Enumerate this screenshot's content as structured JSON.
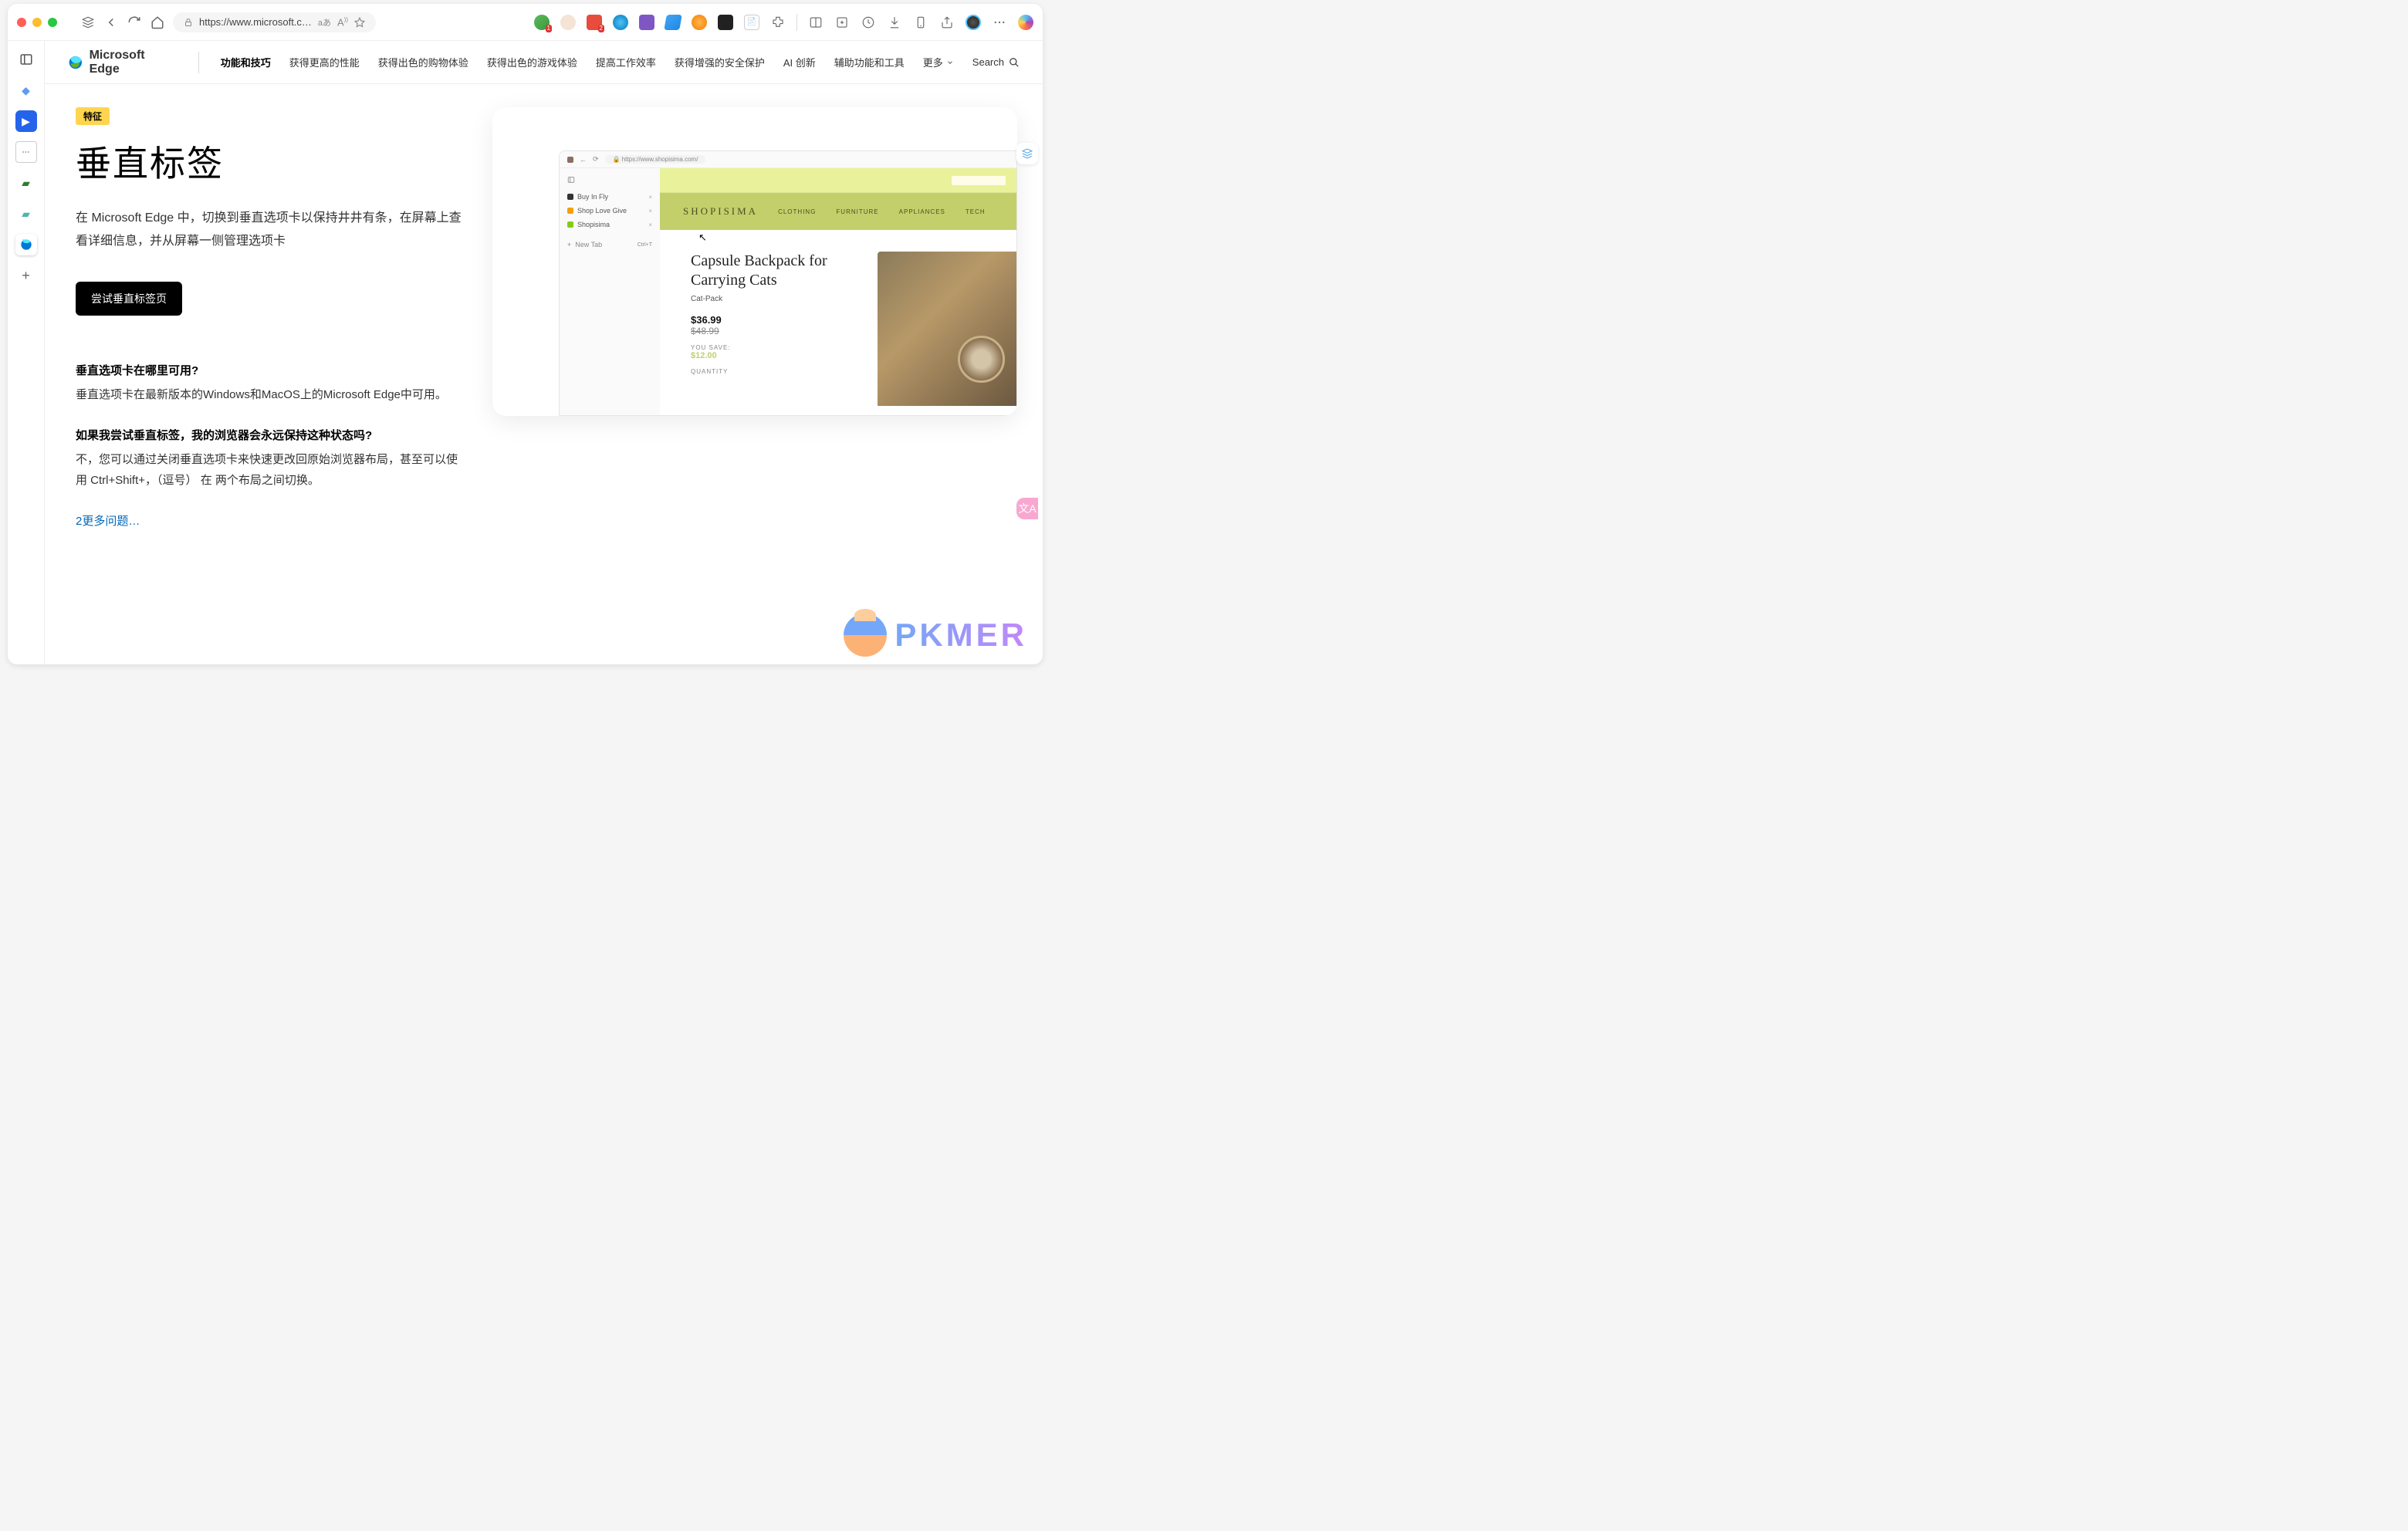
{
  "chrome": {
    "url": "https://www.microsoft.c…",
    "lang_indicator": "aあ",
    "ext_badges": {
      "green": "1",
      "red": "2"
    }
  },
  "left_rail": {
    "items": [
      "panel",
      "diamond",
      "play",
      "subtitle",
      "flag-green",
      "flag-teal",
      "edge"
    ],
    "plus": "+"
  },
  "site_nav": {
    "brand": "Microsoft Edge",
    "links": [
      "功能和技巧",
      "获得更高的性能",
      "获得出色的购物体验",
      "获得出色的游戏体验",
      "提高工作效率",
      "获得增强的安全保护",
      "AI 创新",
      "辅助功能和工具"
    ],
    "more": "更多",
    "search": "Search"
  },
  "page": {
    "badge": "特征",
    "title": "垂直标签",
    "desc": "在 Microsoft Edge 中，切换到垂直选项卡以保持井井有条，在屏幕上查看详细信息，并从屏幕一侧管理选项卡",
    "cta": "尝试垂直标签页",
    "faq": [
      {
        "q": "垂直选项卡在哪里可用?",
        "a": "垂直选项卡在最新版本的Windows和MacOS上的Microsoft Edge中可用。"
      },
      {
        "q": "如果我尝试垂直标签，我的浏览器会永远保持这种状态吗?",
        "a": "不，您可以通过关闭垂直选项卡来快速更改回原始浏览器布局，甚至可以使用 Ctrl+Shift+，（逗号） 在 两个布局之间切换。"
      }
    ],
    "more_link": "2更多问题…"
  },
  "demo": {
    "url": "https://www.shopisima.com/",
    "tabs": [
      {
        "name": "Buy In Fly",
        "color": "#333"
      },
      {
        "name": "Shop Love Give",
        "color": "#f59e0b"
      },
      {
        "name": "Shopisima",
        "color": "#84cc16"
      }
    ],
    "new_tab": "New Tab",
    "new_tab_kbd": "Ctrl+T",
    "logo": "SHOPISIMA",
    "nav": [
      "CLOTHING",
      "FURNITURE",
      "APPLIANCES",
      "TECH"
    ],
    "product": {
      "title": "Capsule Backpack for Carrying Cats",
      "sub": "Cat-Pack",
      "price": "$36.99",
      "old_price": "$48.99",
      "save_label": "YOU SAVE:",
      "save_value": "$12.00",
      "qty_label": "QUANTITY"
    }
  },
  "watermark": "PKMER"
}
